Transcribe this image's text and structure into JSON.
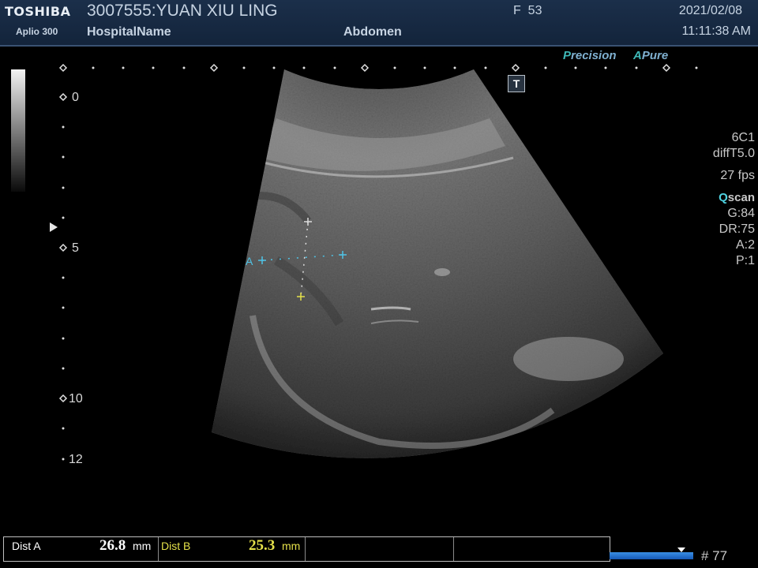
{
  "header": {
    "brand": "TOSHIBA",
    "model": "Aplio 300",
    "patient": "3007555:YUAN XIU LING",
    "hospital": "HospitalName",
    "exam": "Abdomen",
    "frame_label": "F",
    "frame_value": "53",
    "date": "2021/02/08",
    "time": "11:11:38 AM"
  },
  "logos": {
    "precision_letter": "P",
    "precision_rest": "recision",
    "apure_letter": "A",
    "apure_rest": "Pure"
  },
  "t_button": "T",
  "depth_scale": {
    "labels": [
      "0",
      "5",
      "10",
      "12"
    ]
  },
  "params": {
    "probe": "6C1",
    "mode": "diffT5.0",
    "fps": "27 fps",
    "qscan_q": "Q",
    "qscan_rest": "scan",
    "gain": "G:84",
    "dr": "DR:75",
    "a": "A:2",
    "p": "P:1"
  },
  "caliper": {
    "label": "A"
  },
  "measurements": {
    "a_label": "Dist A",
    "a_value": "26.8",
    "a_unit": "mm",
    "b_label": "Dist B",
    "b_value": "25.3",
    "b_unit": "mm"
  },
  "cine": {
    "frame_count": "# 77"
  },
  "colors": {
    "accent": "#3fb9b8",
    "caliper_a": "#4fc3e6",
    "caliper_b": "#e4e04a"
  }
}
